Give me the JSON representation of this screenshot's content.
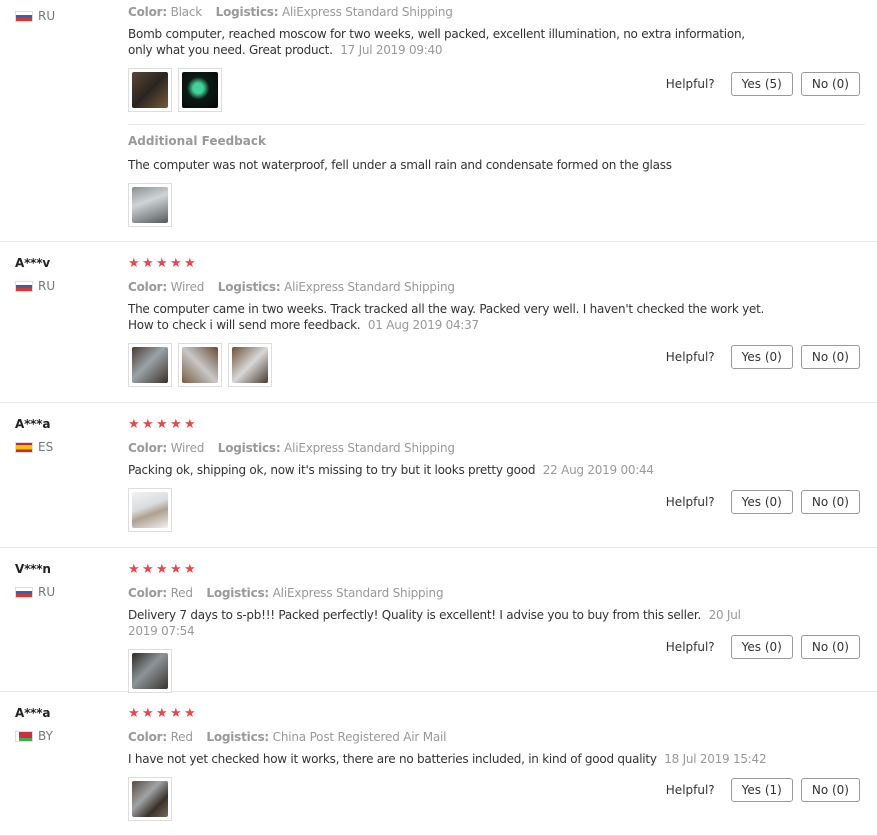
{
  "reviews": [
    {
      "user": "",
      "country": "RU",
      "stars": 0,
      "color_label": "Color:",
      "color": "Black",
      "logistics_label": "Logistics:",
      "logistics": "AliExpress Standard Shipping",
      "text": "Bomb computer, reached moscow for two weeks, well packed, excellent illumination, no extra information, only what you need. Great product.",
      "date": "17 Jul 2019 09:40",
      "helpful_label": "Helpful?",
      "yes": "Yes (5)",
      "no": "No (0)",
      "additional_title": "Additional Feedback",
      "additional_text": "The computer was not waterproof, fell under a small rain and condensate formed on the glass"
    },
    {
      "user": "A***v",
      "country": "RU",
      "stars": 5,
      "color_label": "Color:",
      "color": "Wired",
      "logistics_label": "Logistics:",
      "logistics": "AliExpress Standard Shipping",
      "text": "The computer came in two weeks. Track tracked all the way. Packed very well. I haven't checked the work yet. How to check i will send more feedback.",
      "date": "01 Aug 2019 04:37",
      "helpful_label": "Helpful?",
      "yes": "Yes (0)",
      "no": "No (0)"
    },
    {
      "user": "A***a",
      "country": "ES",
      "stars": 5,
      "color_label": "Color:",
      "color": "Wired",
      "logistics_label": "Logistics:",
      "logistics": "AliExpress Standard Shipping",
      "text": "Packing ok, shipping ok, now it's missing to try but it looks pretty good",
      "date": "22 Aug 2019 00:44",
      "helpful_label": "Helpful?",
      "yes": "Yes (0)",
      "no": "No (0)"
    },
    {
      "user": "V***n",
      "country": "RU",
      "stars": 5,
      "color_label": "Color:",
      "color": "Red",
      "logistics_label": "Logistics:",
      "logistics": "AliExpress Standard Shipping",
      "text": "Delivery 7 days to s-pb!!! Packed perfectly! Quality is excellent! I advise you to buy from this seller.",
      "date": "20 Jul 2019 07:54",
      "helpful_label": "Helpful?",
      "yes": "Yes (0)",
      "no": "No (0)"
    },
    {
      "user": "A***a",
      "country": "BY",
      "stars": 5,
      "color_label": "Color:",
      "color": "Red",
      "logistics_label": "Logistics:",
      "logistics": "China Post Registered Air Mail",
      "text": "I have not yet checked how it works, there are no batteries included, in kind of good quality",
      "date": "18 Jul 2019 15:42",
      "helpful_label": "Helpful?",
      "yes": "Yes (1)",
      "no": "No (0)"
    }
  ],
  "colors": {
    "star": "#f0444b",
    "muted": "#999999",
    "border": "#e8e8e8"
  },
  "icons": {
    "star": "star-icon",
    "flag_ru": "flag-ru-icon",
    "flag_es": "flag-es-icon",
    "flag_by": "flag-by-icon"
  }
}
